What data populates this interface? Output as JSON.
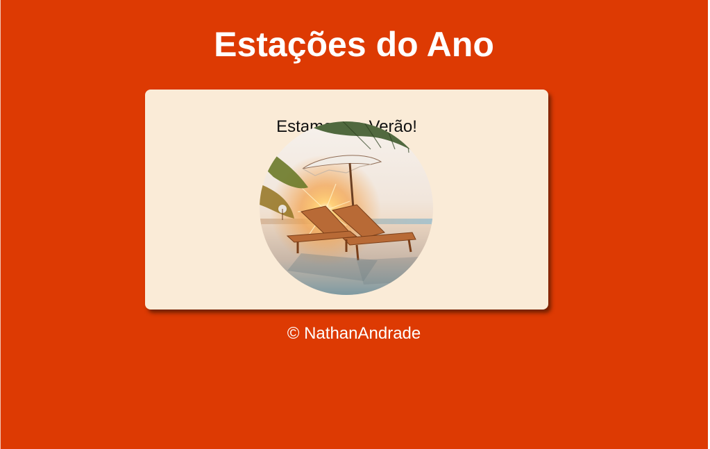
{
  "page": {
    "title": "Estações do Ano",
    "background_color": "#dd3a03"
  },
  "card": {
    "text": "Estamos no Verão!",
    "background_color": "#faebd7",
    "image": {
      "subject": "beach-sunset-photo",
      "shape": "circle"
    }
  },
  "footer": {
    "text": "© NathanAndrade"
  }
}
